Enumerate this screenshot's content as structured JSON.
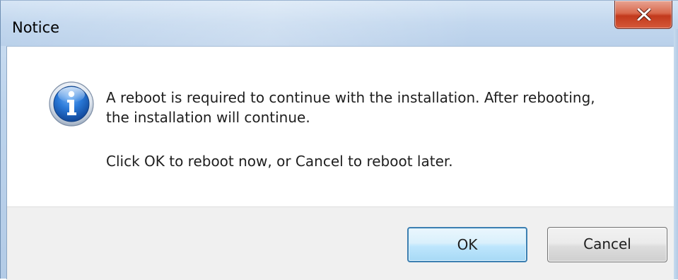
{
  "window": {
    "title": "Notice"
  },
  "titlebar": {
    "close_icon": "close-x-icon"
  },
  "message": {
    "icon": "information-icon",
    "line1": "A reboot is required to continue with the installation. After rebooting,",
    "line2": "the installation will continue.",
    "line3": "Click OK to reboot now, or Cancel to reboot later."
  },
  "buttons": {
    "ok_label": "OK",
    "cancel_label": "Cancel"
  },
  "colors": {
    "close_button": "#c7432a",
    "default_button_border": "#3c7fb1",
    "info_icon_blue": "#1f5fb8"
  }
}
